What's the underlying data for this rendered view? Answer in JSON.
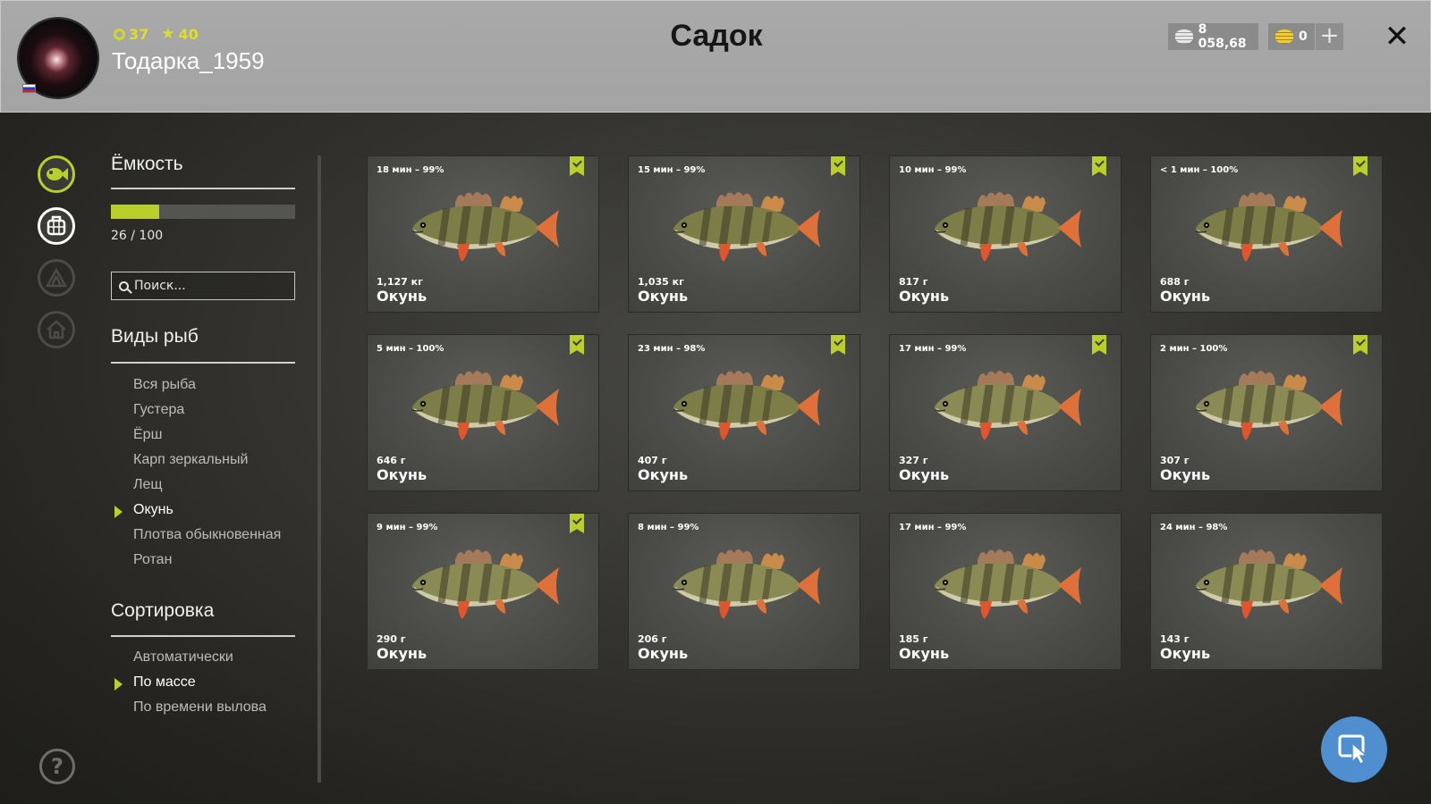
{
  "header": {
    "title": "Садок",
    "player": {
      "name": "Тодарка_1959",
      "level": "37",
      "rank": "40",
      "flag": "ru-flag-icon"
    },
    "silver": "8 058,68",
    "gold": "0",
    "plus_label": "+",
    "close_label": "✕"
  },
  "capacity": {
    "title": "Ёмкость",
    "current": 26,
    "max": 100,
    "text": "26 / 100",
    "accent": "#b8cf2c"
  },
  "search": {
    "placeholder": "Поиск..."
  },
  "species": {
    "title": "Виды рыб",
    "items": [
      "Вся рыба",
      "Густера",
      "Ёрш",
      "Карп зеркальный",
      "Лещ",
      "Окунь",
      "Плотва обыкновенная",
      "Ротан"
    ],
    "selected": "Окунь"
  },
  "sorting": {
    "title": "Сортировка",
    "items": [
      "Автоматически",
      "По массе",
      "По времени вылова"
    ],
    "selected": "По массе"
  },
  "fish": [
    {
      "time": "18 мин – 99%",
      "weight": "1,127 кг",
      "name": "Окунь",
      "bookmarked": true,
      "icon": "perch-icon"
    },
    {
      "time": "15 мин – 99%",
      "weight": "1,035 кг",
      "name": "Окунь",
      "bookmarked": true,
      "icon": "perch-icon"
    },
    {
      "time": "10 мин – 99%",
      "weight": "817 г",
      "name": "Окунь",
      "bookmarked": true,
      "icon": "perch-icon"
    },
    {
      "time": "< 1 мин – 100%",
      "weight": "688 г",
      "name": "Окунь",
      "bookmarked": true,
      "icon": "perch-icon"
    },
    {
      "time": "5 мин – 100%",
      "weight": "646 г",
      "name": "Окунь",
      "bookmarked": true,
      "icon": "perch-icon"
    },
    {
      "time": "23 мин – 98%",
      "weight": "407 г",
      "name": "Окунь",
      "bookmarked": true,
      "icon": "perch-icon"
    },
    {
      "time": "17 мин – 99%",
      "weight": "327 г",
      "name": "Окунь",
      "bookmarked": true,
      "icon": "perch-icon"
    },
    {
      "time": "2 мин – 100%",
      "weight": "307 г",
      "name": "Окунь",
      "bookmarked": true,
      "icon": "perch-icon"
    },
    {
      "time": "9 мин – 99%",
      "weight": "290 г",
      "name": "Окунь",
      "bookmarked": true,
      "icon": "perch-icon"
    },
    {
      "time": "8 мин – 99%",
      "weight": "206 г",
      "name": "Окунь",
      "bookmarked": false,
      "icon": "perch-icon"
    },
    {
      "time": "17 мин – 99%",
      "weight": "185 г",
      "name": "Окунь",
      "bookmarked": false,
      "icon": "perch-icon"
    },
    {
      "time": "24 мин – 98%",
      "weight": "143 г",
      "name": "Окунь",
      "bookmarked": false,
      "icon": "perch-icon"
    }
  ],
  "side_icons": [
    "fish-icon",
    "keepnet-icon",
    "tent-icon",
    "home-icon",
    "help-icon"
  ],
  "fab_icon": "cursor-icon"
}
